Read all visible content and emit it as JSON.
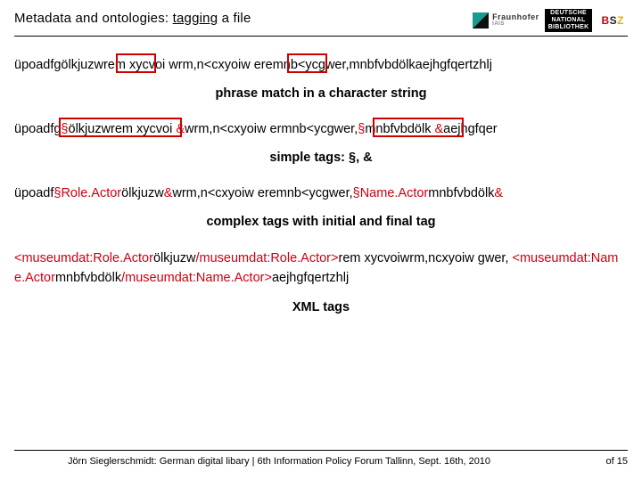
{
  "header": {
    "title_a": "Metadata and ontologies: ",
    "title_b": "tagging",
    "title_c": " a file",
    "logo_fh_top": "Fraunhofer",
    "logo_fh_sub": "IAIS",
    "logo_dnb_l1": "DEUTSCHE",
    "logo_dnb_l2": "NATIONAL",
    "logo_dnb_l3": "BIBLIOTHEK",
    "logo_bsz": "BSZ"
  },
  "section1": {
    "text": "üpoadfgölkjuzwrem xycvoi wrm,n<cxyoiw eremnb<ycgwer,mnbfvbdölkaejhgfqertzhlj",
    "caption": "phrase match in a character string"
  },
  "section2": {
    "t1": "üpoadfg",
    "m1": "§",
    "t2": "ölkjuzwrem xycvoi ",
    "m2": "&",
    "t3": "wrm,n<cxyoiw ermnb<ycgwer,",
    "m3": "§",
    "t4": "mnbfvbdölk ",
    "m4": "&",
    "t5": "aejhgfqer",
    "caption": "simple tags: §, &"
  },
  "section3": {
    "t1": "üpoadf",
    "m1": "§",
    "r1": "Role.Actor",
    "t2": "ölkjuzw",
    "m2": "&",
    "t3": "wrm,n<cxyoiw eremnb<ycgwer,",
    "m3": "§",
    "r2": "Name.Actor",
    "t4": "mnbfvbdölk",
    "m4": "&",
    "caption": "complex tags with initial and final tag"
  },
  "section4": {
    "o1": "<",
    "tag1": "museumdat:Role.Actor",
    "t1": "ölkjuzw",
    "c1": "/museumdat:Role.Actor",
    "cl1": ">",
    "t2": "rem xycvoiwrm,ncxyoiw gwer, ",
    "o2": "<",
    "tag2": "museumdat:Name.Actor",
    "t3": "mnbfvbdölk",
    "c2": "/museumdat:Name.Actor",
    "cl2": ">",
    "t4": "aejhgfqertzhlj",
    "caption": "XML tags"
  },
  "footer": {
    "credit": "Jörn Sieglerschmidt: German digital libary | 6th Information Policy Forum Tallinn, Sept. 16th, 2010",
    "page": "of 15"
  }
}
